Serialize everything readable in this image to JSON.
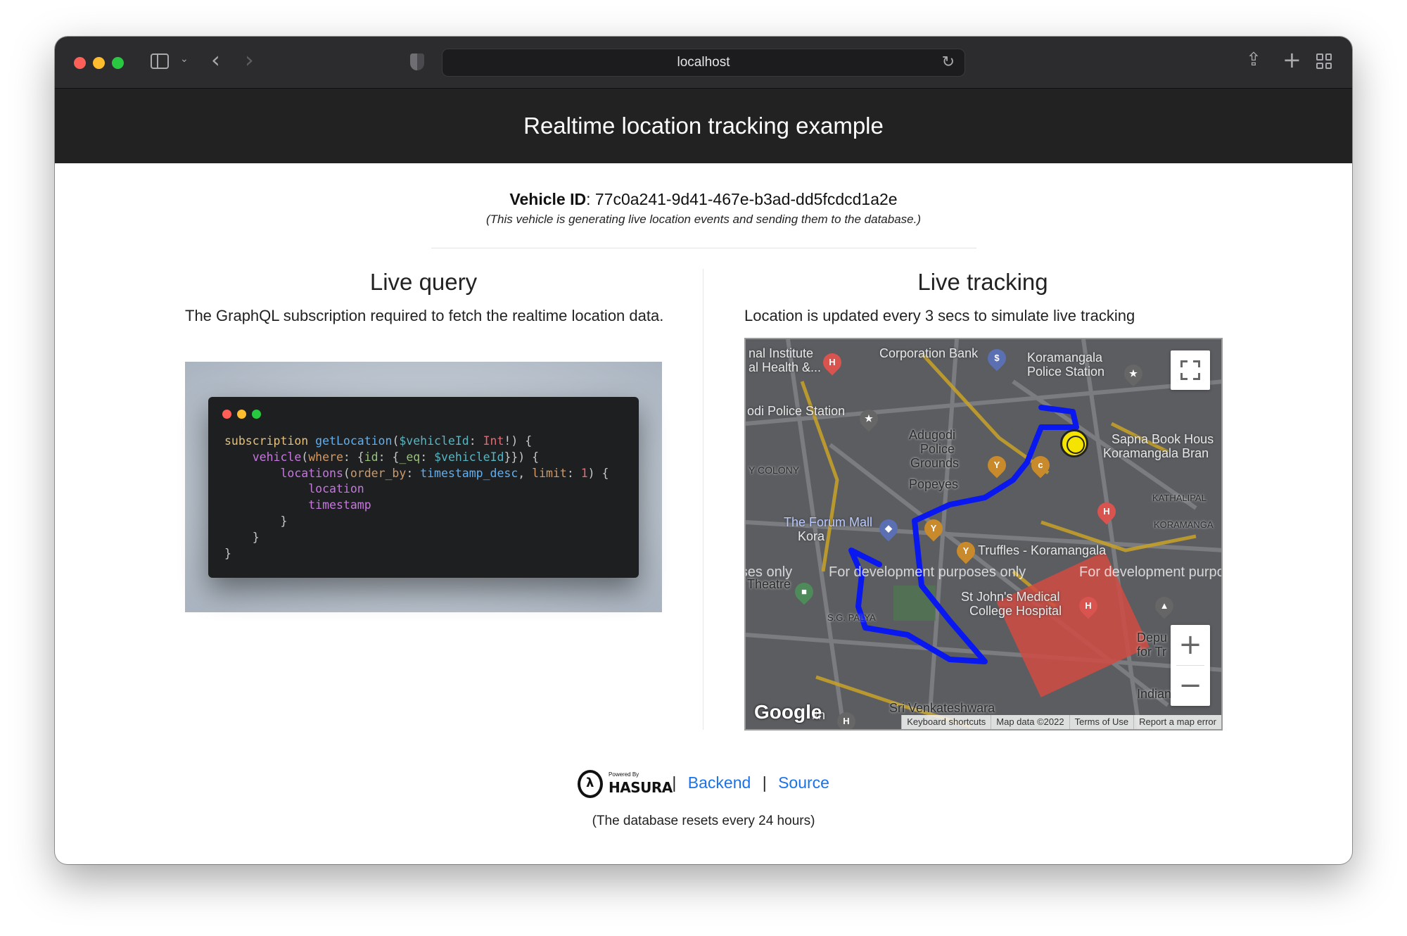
{
  "browser": {
    "address": "localhost"
  },
  "header": {
    "title": "Realtime location tracking example"
  },
  "vehicle": {
    "label": "Vehicle ID",
    "id": "77c0a241-9d41-467e-b3ad-dd5fcdcd1a2e",
    "note": "(This vehicle is generating live location events and sending them to the database.)"
  },
  "live_query": {
    "title": "Live query",
    "description": "The GraphQL subscription required to fetch the realtime location data."
  },
  "live_tracking": {
    "title": "Live tracking",
    "description": "Location is updated every 3 secs to simulate live tracking"
  },
  "map": {
    "labels": [
      "nal Institute",
      "al Health &...",
      "Corporation Bank",
      "Koramangala",
      "Police Station",
      "odi Police Station",
      "Adugodi",
      "Police",
      "Grounds",
      "Sapna Book Hous",
      "Koramangala Bran",
      "Y COLONY",
      "Popeyes",
      "KATHALIPAL",
      "KORAMANGA",
      "The Forum Mall",
      "Kora",
      "Truffles - Koramangala",
      "Theatre",
      "St John's Medical",
      "College Hospital",
      "S.G. PALYA",
      "Depu",
      "for Tr",
      "Indian F",
      "Sri Venkateshwara",
      "lth"
    ],
    "dev_watermark": "For development purposes only",
    "google": "Google",
    "attribution": [
      "Keyboard shortcuts",
      "Map data ©2022",
      "Terms of Use",
      "Report a map error"
    ],
    "zoom_in": "+",
    "zoom_out": "−"
  },
  "footer": {
    "powered_by": "Powered By",
    "brand": "HASURA",
    "backend_link": "Backend",
    "source_link": "Source",
    "separator": "|",
    "note": "(The database resets every 24 hours)"
  },
  "icons": {
    "back": "chevron-left-icon",
    "forward": "chevron-right-icon",
    "reload": "reload-icon",
    "share": "share-icon",
    "new_tab": "plus-icon",
    "tab_overview": "tabs-grid-icon"
  },
  "colors": {
    "header_bg": "#222222",
    "link": "#1a73e8",
    "route": "#0a18f0",
    "marker": "#f5e400"
  }
}
